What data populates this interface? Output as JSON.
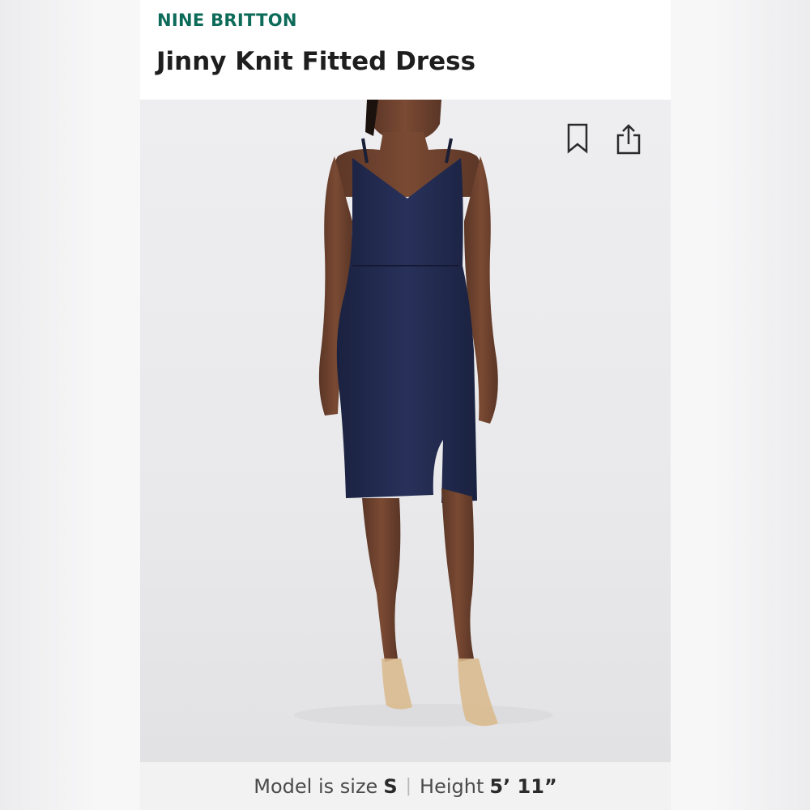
{
  "product": {
    "brand": "NINE BRITTON",
    "title": "Jinny Knit Fitted Dress"
  },
  "actions": {
    "save_icon": "bookmark-icon",
    "share_icon": "share-icon"
  },
  "model_info": {
    "size_label": "Model is size",
    "size_value": "S",
    "separator": "|",
    "height_label": "Height",
    "height_value": "5’ 11”"
  },
  "colors": {
    "brand": "#0d6b5a",
    "dress": "#1f2744"
  }
}
